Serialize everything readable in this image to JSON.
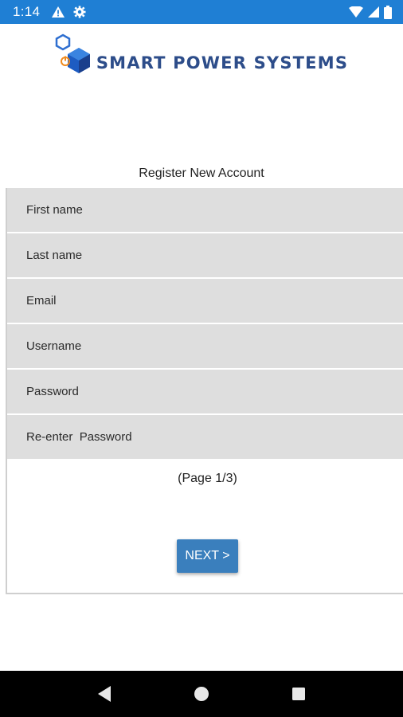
{
  "status_bar": {
    "time": "1:14",
    "left_icons": [
      "warning-icon",
      "gear-icon"
    ],
    "right_icons": [
      "wifi-icon",
      "signal-icon",
      "battery-icon"
    ],
    "color": "#1f7fd4"
  },
  "logo": {
    "text": "SMART POWER SYSTEMS",
    "icon": "hexagon-power-logo-icon",
    "text_color": "#2d4d8a"
  },
  "form": {
    "title": "Register New Account",
    "fields": [
      {
        "placeholder": "First name"
      },
      {
        "placeholder": "Last name"
      },
      {
        "placeholder": "Email"
      },
      {
        "placeholder": "Username"
      },
      {
        "placeholder": "Password"
      },
      {
        "placeholder": "Re-enter  Password"
      }
    ],
    "page_indicator": "(Page 1/3)",
    "next_label": "NEXT >",
    "field_bg": "#dedede",
    "button_color": "#3a7fbd"
  },
  "nav_bar": {
    "buttons": [
      "back-icon",
      "home-icon",
      "recents-icon"
    ]
  }
}
